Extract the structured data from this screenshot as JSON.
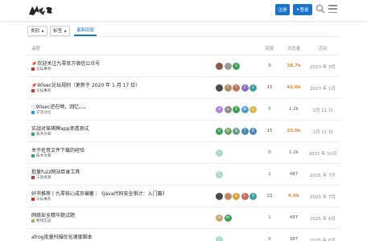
{
  "header": {
    "signup_label": "注册",
    "login_label": "登录",
    "brand_color": "#1a73c9"
  },
  "nav": {
    "category_dropdown": "类别",
    "tag_dropdown": "标签",
    "latest_tab": "最新回复"
  },
  "columns": {
    "topic": "话题",
    "replies": "回复",
    "views": "浏览量",
    "activity": "活动"
  },
  "topics": [
    {
      "title": "欢迎关注九零官方微信公众号",
      "title_icon": "pin-icon",
      "category": "论坛事务",
      "category_color": "#c0392b",
      "avatars": [
        {
          "color": "#8a5a44",
          "letter": ""
        },
        {
          "color": "#999999",
          "letter": ""
        },
        {
          "color": "#3ca055",
          "letter": "S"
        }
      ],
      "replies": "9",
      "views": "38.7k",
      "views_hot": true,
      "activity": "2023 年 3月"
    },
    {
      "title": "90sec论坛规则（更新于 2020 年 1 月 17 日）",
      "title_icon": "pin-icon",
      "category": "论坛事务",
      "category_color": "#c0392b",
      "avatars": [
        {
          "color": "#4a4a4a",
          "letter": ""
        },
        {
          "color": "#b08a5a",
          "letter": "T"
        },
        {
          "color": "#c0705a",
          "letter": "T"
        },
        {
          "color": "#8a6bc0",
          "letter": "Z"
        },
        {
          "color": "#3ca0a0",
          "letter": "S"
        }
      ],
      "replies": "15",
      "views": "41.0k",
      "views_hot": true,
      "activity": "2023 年 1月"
    },
    {
      "title": "90sec还在啊，回忆。。。",
      "title_icon": "checkbox-icon",
      "category": "交流讨论",
      "category_color": "#3498db",
      "avatars": [
        {
          "color": "#b084d8",
          "letter": "A"
        },
        {
          "color": "#888888",
          "letter": "◎"
        },
        {
          "color": "#3ca055",
          "letter": "Z"
        },
        {
          "color": "#4aa0d0",
          "letter": "W"
        },
        {
          "color": "#d8b850",
          "letter": "E"
        }
      ],
      "replies": "5",
      "views": "1.2k",
      "views_hot": false,
      "activity": "2月 11 日"
    },
    {
      "title": "实战对某棋牌app渗透测试",
      "title_icon": "",
      "category": "技术文章",
      "category_color": "#27ae60",
      "avatars": [
        {
          "color": "#3ca055",
          "letter": "H"
        },
        {
          "color": "#6aa05a",
          "letter": "W"
        },
        {
          "color": "#6aa08a",
          "letter": "B"
        },
        {
          "color": "#4a8ab0",
          "letter": "T"
        },
        {
          "color": "#4a8ab0",
          "letter": "D"
        }
      ],
      "replies": "15",
      "views": "22.9k",
      "views_hot": true,
      "activity": "2月 11 日"
    },
    {
      "title": "关于任意文件下载的经验",
      "title_icon": "",
      "category": "技术文章",
      "category_color": "#27ae60",
      "avatars": [
        {
          "color": "#a8d8c8",
          "letter": "L"
        }
      ],
      "replies": "0",
      "views": "1.2k",
      "views_hot": false,
      "activity": "2025 年 10月"
    },
    {
      "title": "批量fuzz网站目录工具",
      "title_icon": "",
      "category": "工具资源",
      "category_color": "#c0392b",
      "avatars": [
        {
          "color": "#a8d8c8",
          "letter": "L"
        }
      ],
      "replies": "1",
      "views": "487",
      "views_hot": false,
      "activity": "2025 年 7月"
    },
    {
      "title": "好书推荐 | 九零核心成员编著｜《Java代码安全审计：入门篇》",
      "title_icon": "",
      "category": "论坛事务",
      "category_color": "#c0392b",
      "avatars": [
        {
          "color": "#4a4a4a",
          "letter": ""
        },
        {
          "color": "#c08a6a",
          "letter": ""
        },
        {
          "color": "#d8a040",
          "letter": "G"
        },
        {
          "color": "#c0705a",
          "letter": "C"
        },
        {
          "color": "#3ca0a0",
          "letter": "S"
        }
      ],
      "replies": "22",
      "views": "6.6k",
      "views_hot": true,
      "activity": "2025 年 7月"
    },
    {
      "title": "网络安全精华题试题",
      "title_icon": "",
      "category": "靶场实战",
      "category_color": "#8bc34a",
      "avatars": [
        {
          "color": "#c8a870",
          "letter": "A"
        },
        {
          "color": "#3ca055",
          "letter": "M"
        }
      ],
      "replies": "1",
      "views": "487",
      "views_hot": false,
      "activity": "2025 年 6月"
    },
    {
      "title": "afrog批量扫描优化速度脚本",
      "title_icon": "",
      "category": "",
      "category_color": "#27ae60",
      "avatars": [
        {
          "color": "#a8d8c8",
          "letter": "L"
        }
      ],
      "replies": "0",
      "views": "387",
      "views_hot": false,
      "activity": "2025 年 6月"
    }
  ]
}
